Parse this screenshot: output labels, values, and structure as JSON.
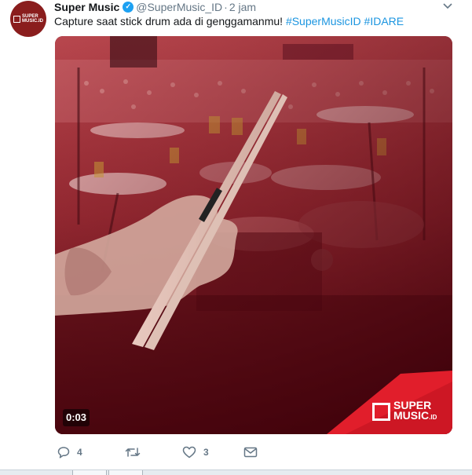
{
  "tweet": {
    "display_name": "Super Music",
    "handle": "@SuperMusic_ID",
    "separator": "·",
    "time": "2 jam",
    "text_plain": "Capture saat stick drum ada di genggamanmu!",
    "hashtags": [
      "#SuperMusicID",
      "#IDARE"
    ],
    "avatar_text": [
      "SUPER",
      "MUSIC.ID"
    ],
    "verified": true
  },
  "media": {
    "duration": "0:03",
    "brand_words": [
      "SUPER",
      "MUSIC",
      ".ID"
    ],
    "accent_color": "#e11e2b",
    "overlay_color": "#7a0f19"
  },
  "actions": {
    "reply_count": "4",
    "retweet_count": "",
    "like_count": "3"
  },
  "icons": {
    "reply": "reply-icon",
    "retweet": "retweet-icon",
    "like": "heart-icon",
    "dm": "envelope-icon",
    "caret": "chevron-down-icon",
    "verified": "verified-badge-icon"
  }
}
